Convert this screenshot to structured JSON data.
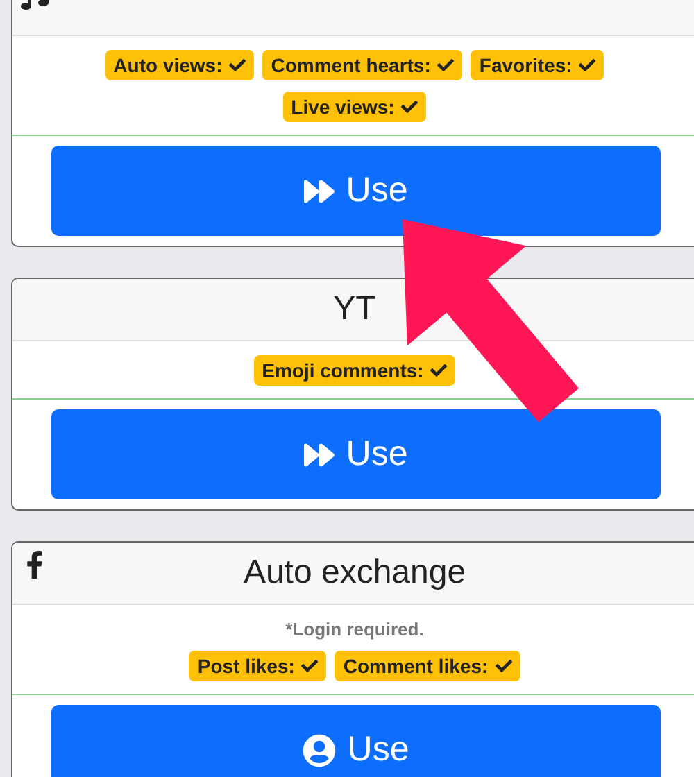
{
  "cards": [
    {
      "kind": "music",
      "badges": [
        {
          "label": "Auto views:",
          "checked": true
        },
        {
          "label": "Comment hearts:",
          "checked": true
        },
        {
          "label": "Favorites:",
          "checked": true
        },
        {
          "label": "Live views:",
          "checked": true
        }
      ],
      "button": {
        "label": "Use"
      }
    },
    {
      "kind": "plain",
      "title": "YT",
      "badges": [
        {
          "label": "Emoji comments:",
          "checked": true
        }
      ],
      "button": {
        "label": "Use"
      }
    },
    {
      "kind": "login",
      "title": "Auto exchange",
      "note": "*Login required.",
      "badges": [
        {
          "label": "Post likes:",
          "checked": true
        },
        {
          "label": "Comment likes:",
          "checked": true
        }
      ],
      "button": {
        "label": "Use"
      }
    }
  ],
  "pointer": {
    "kind": "arrow"
  }
}
